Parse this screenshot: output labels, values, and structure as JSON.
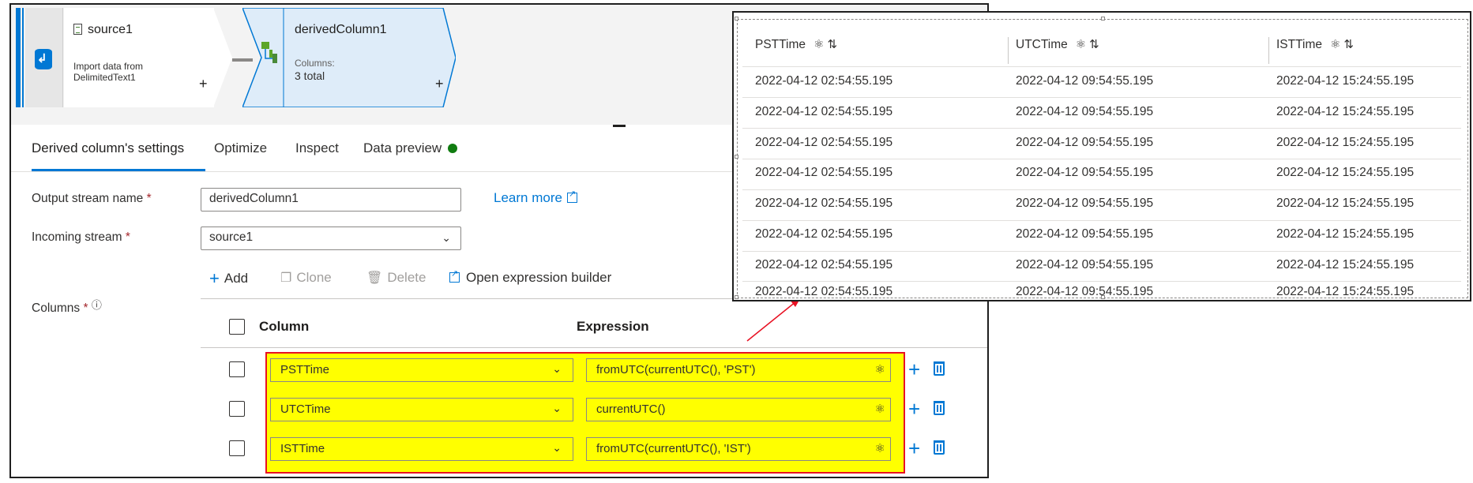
{
  "canvas": {
    "source_node": {
      "title": "source1",
      "subtitle": "Import data from DelimitedText1",
      "plus": "+"
    },
    "derived_node": {
      "title": "derivedColumn1",
      "columns_label": "Columns:",
      "columns_total": "3 total",
      "plus": "+"
    }
  },
  "tabs": [
    {
      "label": "Derived column's settings",
      "active": true
    },
    {
      "label": "Optimize"
    },
    {
      "label": "Inspect"
    },
    {
      "label": "Data preview",
      "status_color": "#107c10"
    }
  ],
  "form": {
    "output_stream": {
      "label": "Output stream name",
      "required": "*",
      "value": "derivedColumn1"
    },
    "learn_more": "Learn more",
    "incoming_stream": {
      "label": "Incoming stream",
      "required": "*",
      "value": "source1"
    },
    "columns_label": "Columns",
    "columns_required": "*",
    "info_icon": "ⓘ"
  },
  "toolbar": {
    "add": "Add",
    "clone": "Clone",
    "delete": "Delete",
    "open_builder": "Open expression builder"
  },
  "table": {
    "headers": {
      "column": "Column",
      "expression": "Expression"
    },
    "rows": [
      {
        "column": "PSTTime",
        "expression": "fromUTC(currentUTC(), 'PST')"
      },
      {
        "column": "UTCTime",
        "expression": "currentUTC()"
      },
      {
        "column": "ISTTime",
        "expression": "fromUTC(currentUTC(), 'IST')"
      }
    ]
  },
  "preview": {
    "headers": [
      "PSTTime",
      "UTCTime",
      "ISTTime"
    ],
    "rows": [
      [
        "2022-04-12 02:54:55.195",
        "2022-04-12 09:54:55.195",
        "2022-04-12 15:24:55.195"
      ],
      [
        "2022-04-12 02:54:55.195",
        "2022-04-12 09:54:55.195",
        "2022-04-12 15:24:55.195"
      ],
      [
        "2022-04-12 02:54:55.195",
        "2022-04-12 09:54:55.195",
        "2022-04-12 15:24:55.195"
      ],
      [
        "2022-04-12 02:54:55.195",
        "2022-04-12 09:54:55.195",
        "2022-04-12 15:24:55.195"
      ],
      [
        "2022-04-12 02:54:55.195",
        "2022-04-12 09:54:55.195",
        "2022-04-12 15:24:55.195"
      ],
      [
        "2022-04-12 02:54:55.195",
        "2022-04-12 09:54:55.195",
        "2022-04-12 15:24:55.195"
      ],
      [
        "2022-04-12 02:54:55.195",
        "2022-04-12 09:54:55.195",
        "2022-04-12 15:24:55.195"
      ],
      [
        "2022-04-12 02:54:55.195",
        "2022-04-12 09:54:55.195",
        "2022-04-12 15:24:55.195"
      ]
    ]
  },
  "colors": {
    "accent": "#0078d4",
    "highlight": "#ffff00",
    "annotation": "#e81123",
    "node_selected": "#deecf9"
  }
}
